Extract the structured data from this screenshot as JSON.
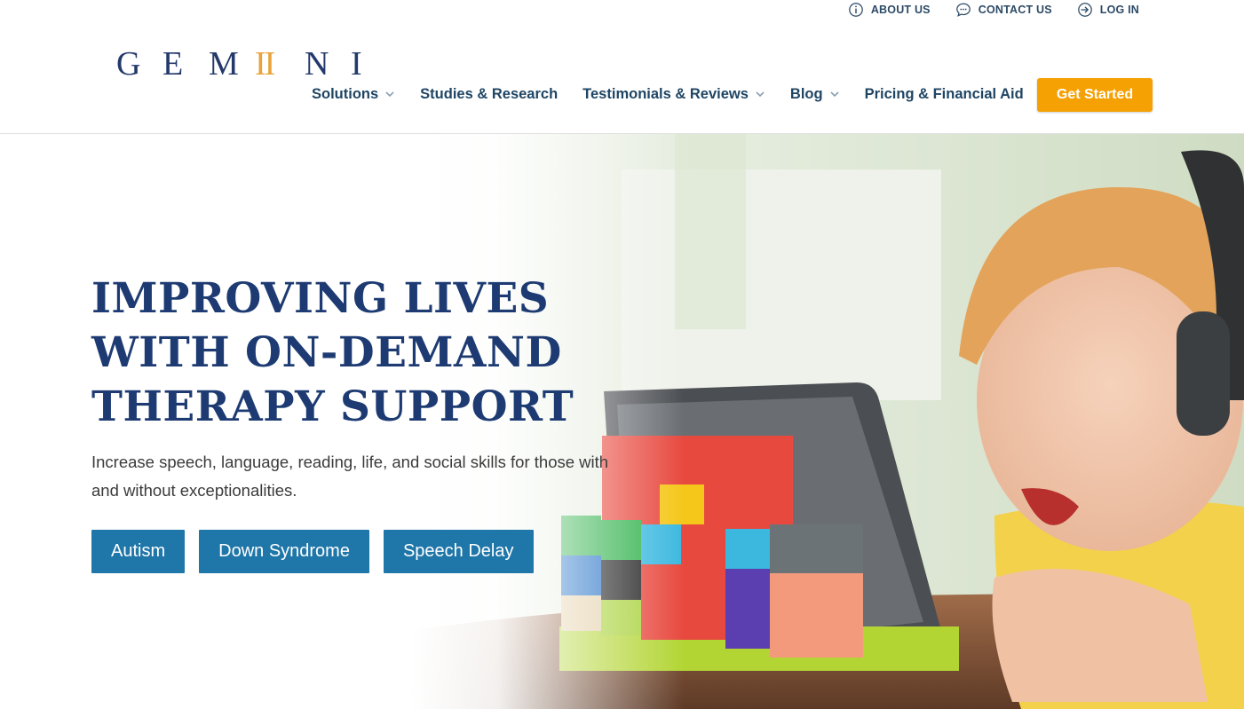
{
  "utility_links": [
    {
      "label": "ABOUT US",
      "icon": "info-icon"
    },
    {
      "label": "CONTACT US",
      "icon": "chat-icon"
    },
    {
      "label": "LOG IN",
      "icon": "login-icon"
    }
  ],
  "logo": {
    "letters": [
      "G",
      "E",
      "M",
      "II",
      "N",
      "I"
    ]
  },
  "nav": {
    "items": [
      {
        "label": "Solutions",
        "dropdown": true
      },
      {
        "label": "Studies & Research",
        "dropdown": false
      },
      {
        "label": "Testimonials & Reviews",
        "dropdown": true
      },
      {
        "label": "Blog",
        "dropdown": true
      },
      {
        "label": "Pricing & Financial Aid",
        "dropdown": false
      }
    ],
    "cta": "Get Started"
  },
  "hero": {
    "headline_lines": [
      "IMPROVING LIVES",
      "WITH ON-DEMAND",
      "THERAPY SUPPORT"
    ],
    "subtitle": "Increase speech, language, reading, life, and social skills for those with and without exceptionalities.",
    "buttons": [
      "Autism",
      "Down Syndrome",
      "Speech Delay"
    ]
  },
  "colors": {
    "navy": "#1d3b72",
    "nav_text": "#1f4564",
    "gold": "#e8a33a",
    "cta": "#f5a104",
    "pill": "#1f76a8"
  }
}
